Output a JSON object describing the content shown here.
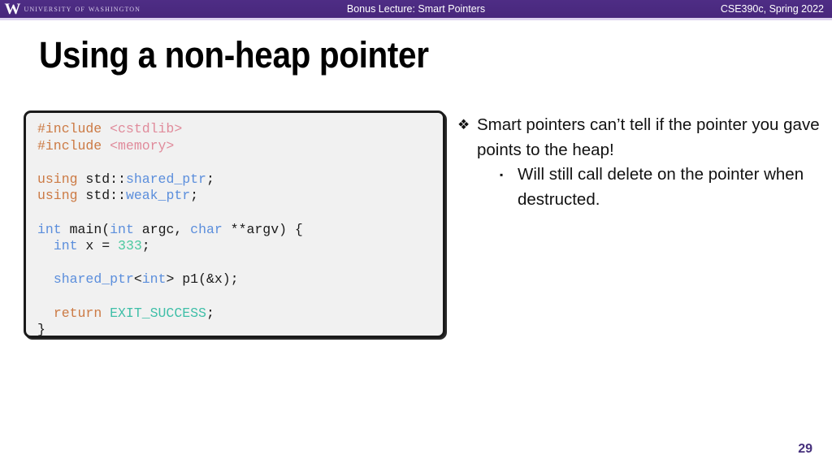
{
  "header": {
    "logo": {
      "w_mark": "W",
      "wordmark": "University of Washington"
    },
    "center_title": "Bonus Lecture: Smart Pointers",
    "course": "CSE390c, Spring 2022",
    "bar_color": "#4b2a80",
    "underline_color": "#ddd2ef"
  },
  "slide": {
    "title": "Using a non-heap pointer",
    "page_number": "29",
    "page_number_color": "#46307c"
  },
  "code": {
    "lines": [
      [
        {
          "t": "#include ",
          "c": "tok-pre"
        },
        {
          "t": "<cstdlib>",
          "c": "tok-hdr"
        }
      ],
      [
        {
          "t": "#include ",
          "c": "tok-pre"
        },
        {
          "t": "<memory>",
          "c": "tok-hdr"
        }
      ],
      [],
      [
        {
          "t": "using ",
          "c": "tok-pre"
        },
        {
          "t": "std::",
          "c": "tok-plain"
        },
        {
          "t": "shared_ptr",
          "c": "tok-type"
        },
        {
          "t": ";",
          "c": "tok-plain"
        }
      ],
      [
        {
          "t": "using ",
          "c": "tok-pre"
        },
        {
          "t": "std::",
          "c": "tok-plain"
        },
        {
          "t": "weak_ptr",
          "c": "tok-type"
        },
        {
          "t": ";",
          "c": "tok-plain"
        }
      ],
      [],
      [
        {
          "t": "int",
          "c": "tok-type"
        },
        {
          "t": " main(",
          "c": "tok-plain"
        },
        {
          "t": "int",
          "c": "tok-type"
        },
        {
          "t": " argc, ",
          "c": "tok-plain"
        },
        {
          "t": "char",
          "c": "tok-type"
        },
        {
          "t": " **argv) {",
          "c": "tok-plain"
        }
      ],
      [
        {
          "t": "  ",
          "c": "tok-plain"
        },
        {
          "t": "int",
          "c": "tok-type"
        },
        {
          "t": " x = ",
          "c": "tok-plain"
        },
        {
          "t": "333",
          "c": "tok-num"
        },
        {
          "t": ";",
          "c": "tok-plain"
        }
      ],
      [],
      [
        {
          "t": "  ",
          "c": "tok-plain"
        },
        {
          "t": "shared_ptr",
          "c": "tok-type"
        },
        {
          "t": "<",
          "c": "tok-plain"
        },
        {
          "t": "int",
          "c": "tok-type"
        },
        {
          "t": "> p1(&x);",
          "c": "tok-plain"
        }
      ],
      [],
      [
        {
          "t": "  ",
          "c": "tok-plain"
        },
        {
          "t": "return ",
          "c": "tok-pre"
        },
        {
          "t": "EXIT_SUCCESS",
          "c": "tok-const"
        },
        {
          "t": ";",
          "c": "tok-plain"
        }
      ],
      [
        {
          "t": "}",
          "c": "tok-plain"
        }
      ]
    ],
    "colors": {
      "background": "#f1f1f1",
      "border": "#1a1a1a",
      "preprocessor": "#cc7a44",
      "header_name": "#e08b9b",
      "type": "#5b8edc",
      "number": "#4dc9a0",
      "constant": "#3fbfa8",
      "plain": "#1a1a1a"
    }
  },
  "bullets": [
    {
      "level": 1,
      "marker": "❖",
      "text": "Smart pointers can’t tell if the pointer you gave points to the heap!"
    },
    {
      "level": 2,
      "marker": "▪",
      "text": "Will still call delete on the pointer when destructed."
    }
  ]
}
